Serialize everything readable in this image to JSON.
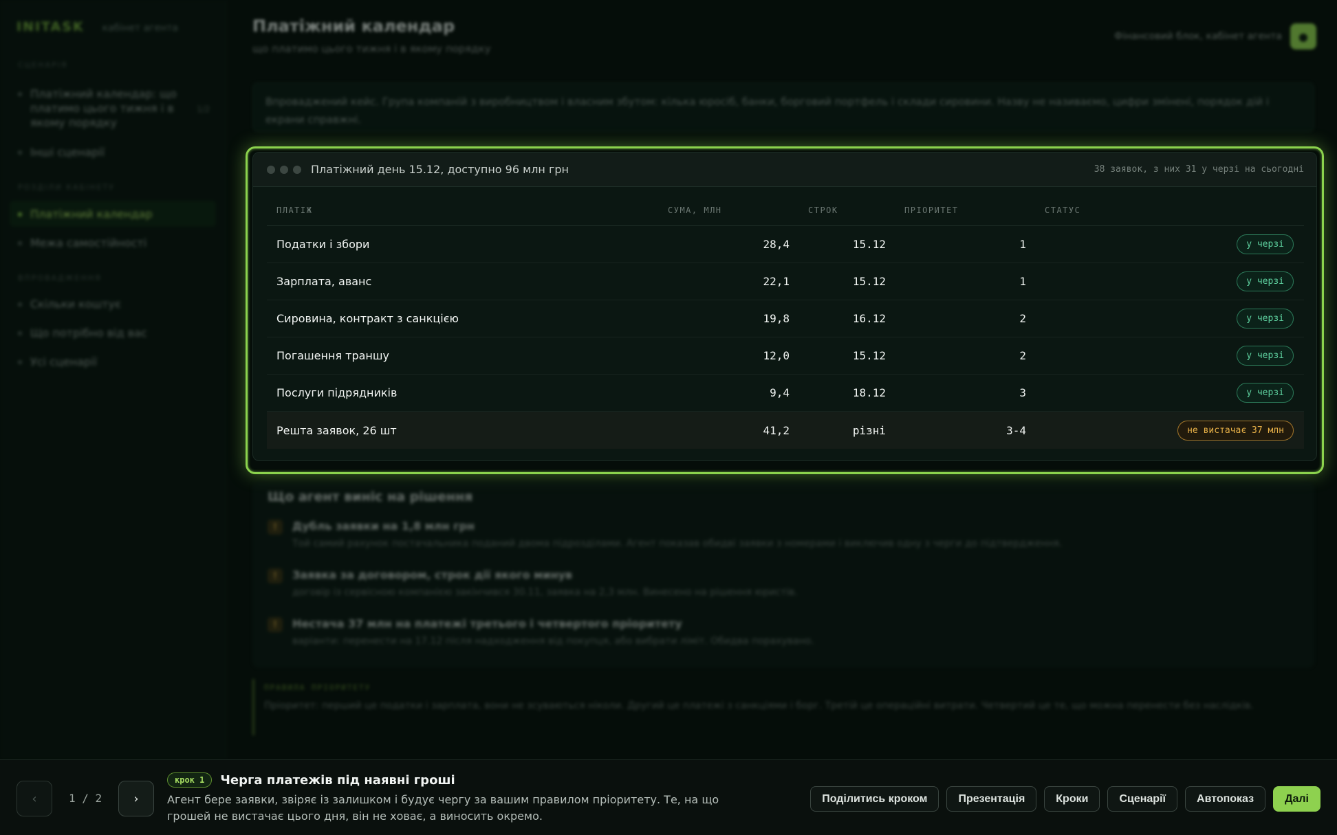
{
  "sidebar": {
    "brand": "INITASK",
    "brand_sub": "кабінет агента",
    "section_scenario": "СЦЕНАРІЯ",
    "scenario_items": [
      {
        "label": "Платіжний календар: що платимо цього тижня і в якому порядку"
      },
      {
        "label": "Інші сценарії"
      }
    ],
    "scenario_count": "1/2",
    "section_cabinet": "РОЗДІЛИ КАБІНЕТУ",
    "cabinet_items": [
      {
        "label": "Платіжний календар"
      },
      {
        "label": "Межа самостійності"
      }
    ],
    "section_rollout": "ВПРОВАДЖЕННЯ",
    "rollout_items": [
      {
        "label": "Скільки коштує"
      },
      {
        "label": "Що потрібно від вас"
      },
      {
        "label": "Усі сценарії"
      }
    ]
  },
  "header": {
    "title": "Платіжний календар",
    "subtitle": "що платимо цього тижня і в якому порядку",
    "right_text": "Фінансовий блок, кабінет агента",
    "avatar_icon": "chat-icon"
  },
  "intro": "Впроваджений кейс. Група компаній з виробництвом і власним збутом: кілька юросіб, банки, борговий портфель і склади сировини. Назву не називаємо, цифри змінені, порядок дій і екрани справжні.",
  "card": {
    "title": "Платіжний день 15.12, доступно 96 млн грн",
    "meta": "38 заявок, з них 31 у черзі на сьогодні",
    "columns": [
      "ПЛАТІЖ",
      "СУМА, МЛН",
      "СТРОК",
      "ПРІОРИТЕТ",
      "СТАТУС"
    ],
    "rows": [
      {
        "name": "Податки і збори",
        "sum": "28,4",
        "date": "15.12",
        "prio": "1",
        "status": "у черзі"
      },
      {
        "name": "Зарплата, аванс",
        "sum": "22,1",
        "date": "15.12",
        "prio": "1",
        "status": "у черзі"
      },
      {
        "name": "Сировина, контракт з санкцією",
        "sum": "19,8",
        "date": "16.12",
        "prio": "2",
        "status": "у черзі"
      },
      {
        "name": "Погашення траншу",
        "sum": "12,0",
        "date": "15.12",
        "prio": "2",
        "status": "у черзі"
      },
      {
        "name": "Послуги підрядників",
        "sum": "9,4",
        "date": "18.12",
        "prio": "3",
        "status": "у черзі"
      },
      {
        "name": "Решта заявок, 26 шт",
        "sum": "41,2",
        "date": "різні",
        "prio": "3-4",
        "status": "не вистачає 37 млн"
      }
    ]
  },
  "decisions": {
    "title": "Що агент виніс на рішення",
    "items": [
      {
        "icon": "!",
        "head": "Дубль заявки на 1,8 млн грн",
        "text": "Той самий рахунок постачальника поданий двома підрозділами. Агент показав обидві заявки з номерами і виключив одну з черги до підтвердження."
      },
      {
        "icon": "!",
        "head": "Заявка за договором, строк дії якого минув",
        "text": "договір із сервісною компанією закінчився 30.11, заявка на 2,3 млн. Винесено на рішення юристів."
      },
      {
        "icon": "!",
        "head": "Нестача 37 млн на платежі третього і четвертого пріоритету",
        "text": "варіанти: перенести на 17.12 після надходження від покупця, або вибрати ліміт. Обидва порахувано."
      }
    ]
  },
  "rule": {
    "label": "ПРАВИЛА ПРІОРИТЕТУ",
    "text": "Пріоритет: перший це податки і зарплата, вони не зсуваються ніколи. Другий це платежі з санкціями і борг. Третій це операційні витрати. Четвертий це те, що можна перенести без наслідків."
  },
  "bottom": {
    "pager": "1 / 2",
    "prev_icon": "chevron-left-icon",
    "next_icon": "chevron-right-icon",
    "step_badge": "крок 1",
    "step_title": "Черга платежів під наявні гроші",
    "step_text": "Агент бере заявки, звіряє із залишком і будує чергу за вашим правилом пріоритету. Те, на що грошей не вистачає цього дня, він не ховає, а виносить окремо.",
    "actions": [
      "Поділитись кроком",
      "Презентація",
      "Кроки",
      "Сценарії",
      "Автопоказ"
    ],
    "primary_action": "Далі"
  },
  "colors": {
    "accent": "#8ed14f",
    "queue_badge": "#5fd3a1",
    "warn_badge": "#e8b148",
    "background": "#050d09"
  }
}
